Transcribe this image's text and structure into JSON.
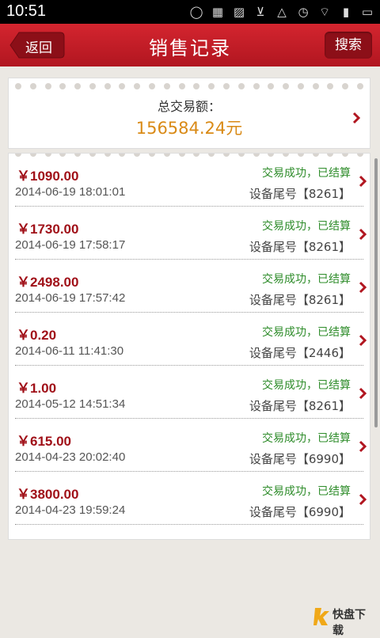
{
  "statusbar": {
    "time": "10:51"
  },
  "header": {
    "title": "销售记录",
    "back_label": "返回",
    "search_label": "搜索"
  },
  "summary": {
    "label": "总交易额：",
    "amount": "156584.24元"
  },
  "records": [
    {
      "price": "￥1090.00",
      "status": "交易成功，已结算",
      "date": "2014-06-19 18:01:01",
      "device": "设备尾号【8261】"
    },
    {
      "price": "￥1730.00",
      "status": "交易成功，已结算",
      "date": "2014-06-19 17:58:17",
      "device": "设备尾号【8261】"
    },
    {
      "price": "￥2498.00",
      "status": "交易成功，已结算",
      "date": "2014-06-19 17:57:42",
      "device": "设备尾号【8261】"
    },
    {
      "price": "￥0.20",
      "status": "交易成功，已结算",
      "date": "2014-06-11 11:41:30",
      "device": "设备尾号【2446】"
    },
    {
      "price": "￥1.00",
      "status": "交易成功，已结算",
      "date": "2014-05-12 14:51:34",
      "device": "设备尾号【8261】"
    },
    {
      "price": "￥615.00",
      "status": "交易成功，已结算",
      "date": "2014-04-23 20:02:40",
      "device": "设备尾号【6990】"
    },
    {
      "price": "￥3800.00",
      "status": "交易成功，已结算",
      "date": "2014-04-23 19:59:24",
      "device": "设备尾号【6990】"
    }
  ],
  "watermark": {
    "text": "快盘下载"
  },
  "colors": {
    "header": "#c41e27",
    "price": "#a01018",
    "status": "#2e8c2a",
    "amount": "#d98a16"
  }
}
